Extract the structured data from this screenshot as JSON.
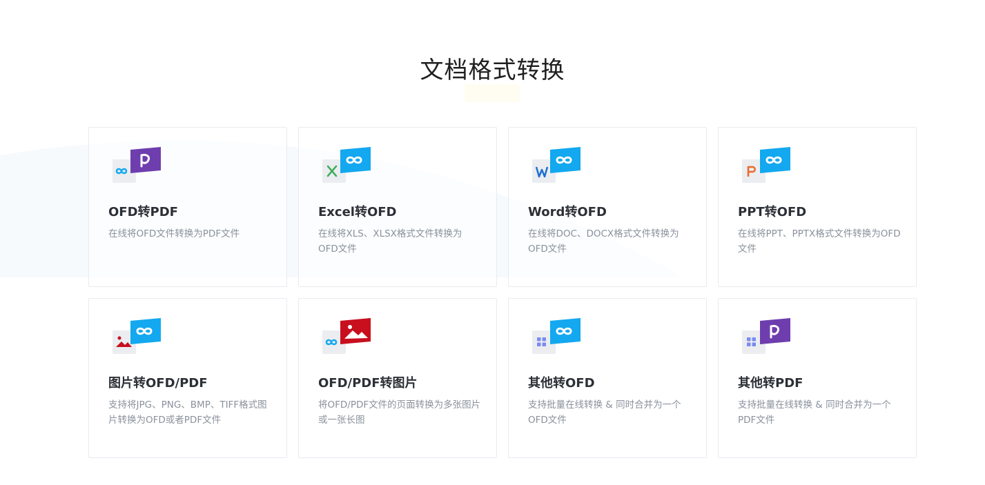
{
  "page": {
    "title": "文档格式转换"
  },
  "colors": {
    "ofd_blue": "#13a8ef",
    "pdf_purple": "#6e3eae",
    "image_red": "#c80f1e",
    "excel_green": "#3fae5a",
    "word_blue": "#1f6fd1",
    "ppt_orange": "#e8692a",
    "other_blue": "#7a8cf0",
    "card_border": "#e8ebf0"
  },
  "cards": [
    {
      "title": "OFD转PDF",
      "desc": "在线将OFD文件转换为PDF文件",
      "source_icon": "ofd-icon",
      "target_icon": "pdf-icon"
    },
    {
      "title": "Excel转OFD",
      "desc": "在线将XLS、XLSX格式文件转换为OFD文件",
      "source_icon": "excel-icon",
      "target_icon": "ofd-icon"
    },
    {
      "title": "Word转OFD",
      "desc": "在线将DOC、DOCX格式文件转换为OFD文件",
      "source_icon": "word-icon",
      "target_icon": "ofd-icon"
    },
    {
      "title": "PPT转OFD",
      "desc": "在线将PPT、PPTX格式文件转换为OFD文件",
      "source_icon": "ppt-icon",
      "target_icon": "ofd-icon"
    },
    {
      "title": "图片转OFD/PDF",
      "desc": "支持将JPG、PNG、BMP、TIFF格式图片转换为OFD或者PDF文件",
      "source_icon": "image-icon",
      "target_icon": "ofd-icon"
    },
    {
      "title": "OFD/PDF转图片",
      "desc": "将OFD/PDF文件的页面转换为多张图片或一张长图",
      "source_icon": "ofd-icon",
      "target_icon": "image-icon"
    },
    {
      "title": "其他转OFD",
      "desc": "支持批量在线转换 & 同时合并为一个OFD文件",
      "source_icon": "apps-icon",
      "target_icon": "ofd-icon"
    },
    {
      "title": "其他转PDF",
      "desc": "支持批量在线转换 & 同时合并为一个PDF文件",
      "source_icon": "apps-icon",
      "target_icon": "pdf-icon"
    }
  ]
}
